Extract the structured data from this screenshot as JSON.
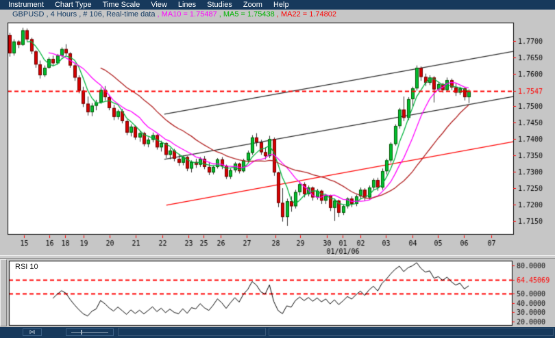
{
  "menubar": {
    "items": [
      "Instrument",
      "Chart Type",
      "Time Scale",
      "View",
      "Lines",
      "Studies",
      "Zoom",
      "Help"
    ]
  },
  "infobar": {
    "title": "GBPUSD , 4 Hours , # 106, Real-time data",
    "ma10": " , MA10 = 1.75487",
    "ma5": " , MA5 = 1.75438",
    "ma22": " , MA22 = 1.74802"
  },
  "colors": {
    "menubar_bg": "#17395c",
    "menubar_text": "#ffffff",
    "window_bg": "#c6c6c6",
    "panel_bg": "#ffffff",
    "panel_border": "#000000",
    "title_text": "#123a63",
    "ma10_text": "#ff00ff",
    "ma5_text": "#00b400",
    "ma22_text": "#ff0000",
    "ma5_line": "#00b43c",
    "ma10_line": "#ff00ff",
    "ma22_line": "#b22222",
    "candle_up": "#00c030",
    "candle_up_border": "#005500",
    "candle_down": "#d80000",
    "candle_down_border": "#660000",
    "wick": "#333333",
    "trend_channel": "#2a2a2a",
    "trend_support": "#ff0000",
    "current_price_line": "#ff0000",
    "axis_tick": "#ff0000",
    "axis_text": "#000000",
    "axis_text_current": "#ff0000",
    "rsi_line": "#000000",
    "statusbar_bg": "#17395c"
  },
  "chart_data": [
    {
      "type": "candlestick",
      "instrument": "GBPUSD",
      "timeframe": "4 Hours",
      "bar_count_label": "# 106",
      "ylim": [
        1.711,
        1.7756
      ],
      "current_price": 1.7547,
      "dashed_lines": [
        1.7547
      ],
      "y_axis": {
        "ticks": [
          {
            "v": 1.77,
            "t": "1.7700"
          },
          {
            "v": 1.765,
            "t": "1.7650"
          },
          {
            "v": 1.76,
            "t": "1.7600"
          },
          {
            "v": 1.7547,
            "t": "1.7547",
            "red": true
          },
          {
            "v": 1.75,
            "t": "1.7500"
          },
          {
            "v": 1.745,
            "t": "1.7450"
          },
          {
            "v": 1.74,
            "t": "1.7400"
          },
          {
            "v": 1.735,
            "t": "1.7350"
          },
          {
            "v": 1.73,
            "t": "1.7300"
          },
          {
            "v": 1.725,
            "t": "1.7250"
          },
          {
            "v": 1.72,
            "t": "1.7200"
          },
          {
            "v": 1.715,
            "t": "1.7150"
          }
        ]
      },
      "x_axis": {
        "ticks": [
          {
            "t": "15",
            "fx": 0.0325
          },
          {
            "t": "16",
            "fx": 0.0827
          },
          {
            "t": "18",
            "fx": 0.1138
          },
          {
            "t": "19",
            "fx": 0.1504
          },
          {
            "t": "20",
            "fx": 0.2019
          },
          {
            "t": "21",
            "fx": 0.2534
          },
          {
            "t": "22",
            "fx": 0.3062
          },
          {
            "t": "23",
            "fx": 0.3577
          },
          {
            "t": "25",
            "fx": 0.3875
          },
          {
            "t": "26",
            "fx": 0.4214
          },
          {
            "t": "27",
            "fx": 0.4729
          },
          {
            "t": "28",
            "fx": 0.5298
          },
          {
            "t": "29",
            "fx": 0.5786
          },
          {
            "t": "30",
            "fx": 0.6314
          },
          {
            "t": "01",
            "fx": 0.6626,
            "sub": "01/01/06"
          },
          {
            "t": "02",
            "fx": 0.6978
          },
          {
            "t": "03",
            "fx": 0.748
          },
          {
            "t": "04",
            "fx": 0.8008
          },
          {
            "t": "05",
            "fx": 0.851
          },
          {
            "t": "06",
            "fx": 0.9024
          },
          {
            "t": "07",
            "fx": 0.9566
          }
        ]
      },
      "overlays": [
        {
          "name": "MA5",
          "period": 5,
          "value": "1.75438",
          "color": "#00b43c"
        },
        {
          "name": "MA10",
          "period": 10,
          "value": "1.75487",
          "color": "#ff00ff"
        },
        {
          "name": "MA22",
          "period": 22,
          "value": "1.74802",
          "color": "#b22222"
        }
      ],
      "trendlines": [
        {
          "name": "channel-upper",
          "fx1": 0.31,
          "p1": 1.7476,
          "fx2": 1.0,
          "p2": 1.7668,
          "color": "#2a2a2a"
        },
        {
          "name": "channel-lower",
          "fx1": 0.31,
          "p1": 1.7338,
          "fx2": 1.0,
          "p2": 1.753,
          "color": "#2a2a2a"
        },
        {
          "name": "support-red",
          "fx1": 0.314,
          "p1": 1.7198,
          "fx2": 1.0,
          "p2": 1.7392,
          "color": "#ff0000"
        }
      ],
      "candles": [
        [
          1.7718,
          1.7725,
          1.7652,
          1.7662
        ],
        [
          1.7662,
          1.7705,
          1.7655,
          1.7698
        ],
        [
          1.7698,
          1.7702,
          1.7678,
          1.7688
        ],
        [
          1.7688,
          1.774,
          1.7685,
          1.7732
        ],
        [
          1.7732,
          1.7738,
          1.7698,
          1.7705
        ],
        [
          1.7705,
          1.771,
          1.766,
          1.7668
        ],
        [
          1.7668,
          1.7672,
          1.7618,
          1.7628
        ],
        [
          1.7628,
          1.764,
          1.7585,
          1.7595
        ],
        [
          1.7595,
          1.7625,
          1.759,
          1.7618
        ],
        [
          1.7618,
          1.765,
          1.7615,
          1.7645
        ],
        [
          1.7645,
          1.7655,
          1.7622,
          1.7632
        ],
        [
          1.7632,
          1.766,
          1.7628,
          1.7655
        ],
        [
          1.7655,
          1.768,
          1.765,
          1.7675
        ],
        [
          1.7675,
          1.769,
          1.7655,
          1.7662
        ],
        [
          1.7662,
          1.7665,
          1.7618,
          1.7625
        ],
        [
          1.7625,
          1.763,
          1.7578,
          1.7588
        ],
        [
          1.7588,
          1.7595,
          1.754,
          1.7548
        ],
        [
          1.7548,
          1.756,
          1.7498,
          1.7508
        ],
        [
          1.7508,
          1.753,
          1.7472,
          1.7482
        ],
        [
          1.7482,
          1.751,
          1.747,
          1.7502
        ],
        [
          1.7502,
          1.752,
          1.7488,
          1.7512
        ],
        [
          1.7512,
          1.7558,
          1.7508,
          1.755
        ],
        [
          1.755,
          1.7562,
          1.7518,
          1.7528
        ],
        [
          1.7528,
          1.7535,
          1.7488,
          1.7495
        ],
        [
          1.7495,
          1.7505,
          1.7458,
          1.7468
        ],
        [
          1.7468,
          1.749,
          1.746,
          1.7485
        ],
        [
          1.7485,
          1.7492,
          1.7448,
          1.7455
        ],
        [
          1.7455,
          1.746,
          1.7412,
          1.742
        ],
        [
          1.742,
          1.7445,
          1.7408,
          1.7438
        ],
        [
          1.7438,
          1.7442,
          1.7398,
          1.7405
        ],
        [
          1.7405,
          1.7425,
          1.7392,
          1.7418
        ],
        [
          1.7418,
          1.7422,
          1.7378,
          1.7385
        ],
        [
          1.7385,
          1.7405,
          1.7375,
          1.7398
        ],
        [
          1.7398,
          1.742,
          1.739,
          1.7412
        ],
        [
          1.7412,
          1.7415,
          1.7368,
          1.7375
        ],
        [
          1.7375,
          1.7395,
          1.7362,
          1.7388
        ],
        [
          1.7388,
          1.739,
          1.7342,
          1.7352
        ],
        [
          1.7352,
          1.7372,
          1.7338,
          1.7365
        ],
        [
          1.7365,
          1.737,
          1.7332,
          1.734
        ],
        [
          1.734,
          1.7355,
          1.7318,
          1.7328
        ],
        [
          1.7328,
          1.735,
          1.732,
          1.7345
        ],
        [
          1.7345,
          1.7348,
          1.7302,
          1.731
        ],
        [
          1.731,
          1.7335,
          1.7298,
          1.733
        ],
        [
          1.733,
          1.734,
          1.7312,
          1.7322
        ],
        [
          1.7322,
          1.7345,
          1.7315,
          1.734
        ],
        [
          1.734,
          1.7348,
          1.7308,
          1.7315
        ],
        [
          1.7315,
          1.733,
          1.729,
          1.7298
        ],
        [
          1.7298,
          1.732,
          1.7292,
          1.7315
        ],
        [
          1.7315,
          1.7342,
          1.731,
          1.7338
        ],
        [
          1.7338,
          1.7345,
          1.7308,
          1.7318
        ],
        [
          1.7318,
          1.7322,
          1.7278,
          1.7285
        ],
        [
          1.7285,
          1.731,
          1.7278,
          1.7305
        ],
        [
          1.7305,
          1.733,
          1.7298,
          1.7325
        ],
        [
          1.7325,
          1.7328,
          1.7295,
          1.7302
        ],
        [
          1.7302,
          1.734,
          1.7298,
          1.7335
        ],
        [
          1.7335,
          1.7365,
          1.7328,
          1.7358
        ],
        [
          1.7358,
          1.7412,
          1.7352,
          1.7405
        ],
        [
          1.7405,
          1.7418,
          1.7378,
          1.739
        ],
        [
          1.739,
          1.7398,
          1.7352,
          1.736
        ],
        [
          1.736,
          1.7375,
          1.7338,
          1.7348
        ],
        [
          1.7348,
          1.741,
          1.7342,
          1.74
        ],
        [
          1.74,
          1.7405,
          1.7288,
          1.7298
        ],
        [
          1.7298,
          1.73,
          1.7192,
          1.7205
        ],
        [
          1.7205,
          1.725,
          1.7148,
          1.7162
        ],
        [
          1.7162,
          1.7218,
          1.7135,
          1.721
        ],
        [
          1.721,
          1.7225,
          1.7178,
          1.7195
        ],
        [
          1.7195,
          1.7245,
          1.7188,
          1.7238
        ],
        [
          1.7238,
          1.727,
          1.7228,
          1.7262
        ],
        [
          1.7262,
          1.7268,
          1.7222,
          1.7232
        ],
        [
          1.7232,
          1.7258,
          1.7225,
          1.7252
        ],
        [
          1.7252,
          1.7255,
          1.7212,
          1.7222
        ],
        [
          1.7222,
          1.7248,
          1.7215,
          1.7242
        ],
        [
          1.7242,
          1.7245,
          1.7202,
          1.7212
        ],
        [
          1.7212,
          1.7232,
          1.7202,
          1.7228
        ],
        [
          1.7228,
          1.723,
          1.718,
          1.719
        ],
        [
          1.719,
          1.7218,
          1.715,
          1.7212
        ],
        [
          1.7212,
          1.7215,
          1.7162,
          1.7175
        ],
        [
          1.7175,
          1.72,
          1.7168,
          1.7195
        ],
        [
          1.7195,
          1.7222,
          1.7188,
          1.7218
        ],
        [
          1.7218,
          1.7225,
          1.7192,
          1.7202
        ],
        [
          1.7202,
          1.723,
          1.7195,
          1.7225
        ],
        [
          1.7225,
          1.7252,
          1.7218,
          1.7245
        ],
        [
          1.7245,
          1.725,
          1.7212,
          1.7222
        ],
        [
          1.7222,
          1.7258,
          1.7215,
          1.7252
        ],
        [
          1.7252,
          1.728,
          1.7245,
          1.7275
        ],
        [
          1.7275,
          1.7282,
          1.7242,
          1.7252
        ],
        [
          1.7252,
          1.731,
          1.7245,
          1.7302
        ],
        [
          1.7302,
          1.734,
          1.7292,
          1.7335
        ],
        [
          1.7335,
          1.739,
          1.7328,
          1.7385
        ],
        [
          1.7385,
          1.7445,
          1.738,
          1.744
        ],
        [
          1.744,
          1.7495,
          1.7432,
          1.749
        ],
        [
          1.749,
          1.753,
          1.7455,
          1.7465
        ],
        [
          1.7465,
          1.7528,
          1.7458,
          1.7522
        ],
        [
          1.7522,
          1.756,
          1.7498,
          1.7555
        ],
        [
          1.7555,
          1.7625,
          1.7548,
          1.7618
        ],
        [
          1.7618,
          1.7622,
          1.7578,
          1.759
        ],
        [
          1.759,
          1.76,
          1.7562,
          1.7572
        ],
        [
          1.7572,
          1.7595,
          1.7565,
          1.7588
        ],
        [
          1.7588,
          1.7592,
          1.7512,
          1.7552
        ],
        [
          1.7552,
          1.7575,
          1.7545,
          1.7568
        ],
        [
          1.7568,
          1.7572,
          1.7542,
          1.755
        ],
        [
          1.755,
          1.7588,
          1.7545,
          1.758
        ],
        [
          1.758,
          1.7585,
          1.755,
          1.7558
        ],
        [
          1.7558,
          1.757,
          1.7532,
          1.7542
        ],
        [
          1.7542,
          1.756,
          1.7535,
          1.7555
        ],
        [
          1.7555,
          1.7558,
          1.7518,
          1.7528
        ],
        [
          1.7528,
          1.7552,
          1.751,
          1.7547
        ]
      ]
    },
    {
      "type": "line",
      "label": "RSI 10",
      "period": 10,
      "current_value": "64.45069",
      "ylim": [
        16.3,
        85.1
      ],
      "dashed_lines": [
        64.45069,
        50
      ],
      "y_axis": {
        "ticks": [
          {
            "v": 80,
            "t": "80.0000"
          },
          {
            "v": 64.45069,
            "t": "64.45069",
            "red": true
          },
          {
            "v": 50,
            "t": "50.0000"
          },
          {
            "v": 40,
            "t": "40.0000"
          },
          {
            "v": 30,
            "t": "30.0000"
          },
          {
            "v": 20,
            "t": "20.0000"
          }
        ]
      }
    }
  ],
  "status_bar": {
    "controls": [
      {
        "icon": "pan-handle-icon"
      },
      {
        "icon": "zoom-slider-icon"
      }
    ]
  }
}
